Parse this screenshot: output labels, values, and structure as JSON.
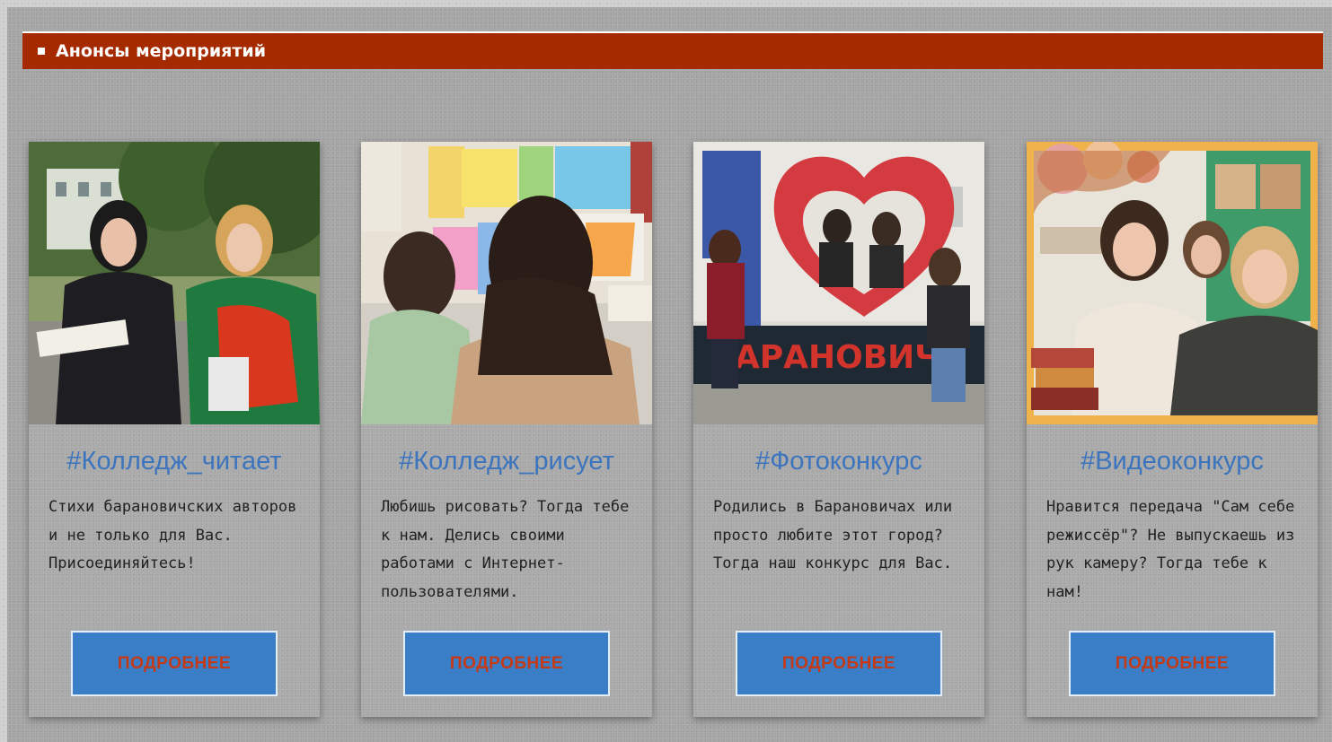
{
  "section": {
    "title": "Анонсы мероприятий",
    "accent_color": "#a52a00"
  },
  "cards": [
    {
      "title": "#Колледж_читает",
      "text": "Стихи барановичских авторов и не только для Вас. Присоединяйтесь!",
      "button": "ПОДРОБНЕЕ"
    },
    {
      "title": "#Колледж_рисует",
      "text": "Любишь рисовать? Тогда тебе к нам. Делись своими работами с Интернет-пользователями.",
      "button": "ПОДРОБНЕЕ"
    },
    {
      "title": "#Фотоконкурс",
      "text": "Родились в Барановичах или просто любите этот город? Тогда наш конкурс для Вас.",
      "button": "ПОДРОБНЕЕ",
      "photo_sign_text": "БАРАНОВИЧИ"
    },
    {
      "title": "#Видеоконкурс",
      "text": "Нравится передача \"Сам себе режиссёр\"? Не выпускаешь из рук камеру? Тогда тебе к нам!",
      "button": "ПОДРОБНЕЕ"
    }
  ],
  "colors": {
    "title_blue": "#3c74bd",
    "button_blue": "#3a7ec8",
    "button_text": "#c43a17"
  }
}
